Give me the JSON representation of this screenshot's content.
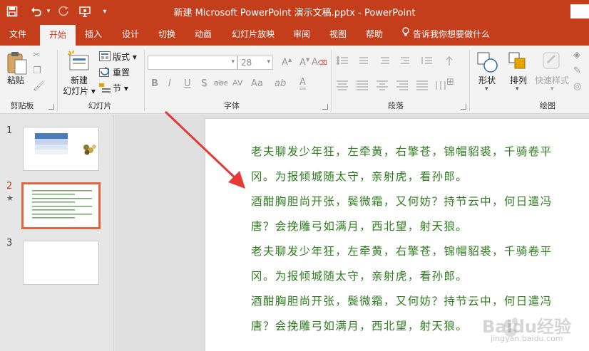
{
  "window": {
    "title": "新建 Microsoft PowerPoint 演示文稿.pptx  -  PowerPoint"
  },
  "quick_access": {
    "icons": [
      "save-icon",
      "undo-icon",
      "redo-icon",
      "start-presentation-icon",
      "customize-icon"
    ]
  },
  "tabs": [
    {
      "label": "文件"
    },
    {
      "label": "开始"
    },
    {
      "label": "插入"
    },
    {
      "label": "设计"
    },
    {
      "label": "切换"
    },
    {
      "label": "动画"
    },
    {
      "label": "幻灯片放映"
    },
    {
      "label": "审阅"
    },
    {
      "label": "视图"
    },
    {
      "label": "帮助"
    }
  ],
  "tell_me": "告诉我你想要做什么",
  "ribbon": {
    "clipboard": {
      "group_label": "剪贴板",
      "paste_label": "粘贴"
    },
    "slides": {
      "group_label": "幻灯片",
      "new_slide_line1": "新建",
      "new_slide_line2": "幻灯片",
      "layout_label": "版式",
      "reset_label": "重置",
      "section_label": "节"
    },
    "font": {
      "group_label": "字体",
      "font_name": "",
      "font_size": "28",
      "format_buttons": [
        "B",
        "I",
        "U",
        "S",
        "abc",
        "AV",
        "Aa",
        "A"
      ]
    },
    "paragraph": {
      "group_label": "段落"
    },
    "drawing": {
      "group_label": "绘图",
      "shapes_label": "形状",
      "arrange_label": "排列",
      "quick_styles_label": "快速样式"
    }
  },
  "slides": [
    {
      "number": "1"
    },
    {
      "number": "2",
      "marker": "★"
    },
    {
      "number": "3"
    }
  ],
  "slide_content": {
    "paragraphs": [
      {
        "line1": "老夫聊发少年狂，左牵黄，右擎苍，锦帽貂裘，千骑卷平",
        "line2": "冈。为报倾城随太守，亲射虎，看孙郎。"
      },
      {
        "line1": "酒酣胸胆尚开张，鬓微霜，又何妨？持节云中，何日遣冯",
        "line2": "唐？会挽雕弓如满月，西北望，射天狼。"
      },
      {
        "line1": "老夫聊发少年狂，左牵黄，右擎苍，锦帽貂裘，千骑卷平",
        "line2": "冈。为报倾城随太守，亲射虎，看孙郎。"
      },
      {
        "line1": "酒酣胸胆尚开张，鬓微霜，又何妨？持节云中，何日遣冯",
        "line2": "唐？会挽雕弓如满月，西北望，射天狼。"
      }
    ]
  },
  "watermark": {
    "brand": "Baidu经验",
    "url": "jingyan.baidu.com"
  },
  "colors": {
    "accent": "#c43e1c",
    "text_green": "#2e7d1e",
    "selection": "#e3663f",
    "arrow": "#e53935"
  }
}
